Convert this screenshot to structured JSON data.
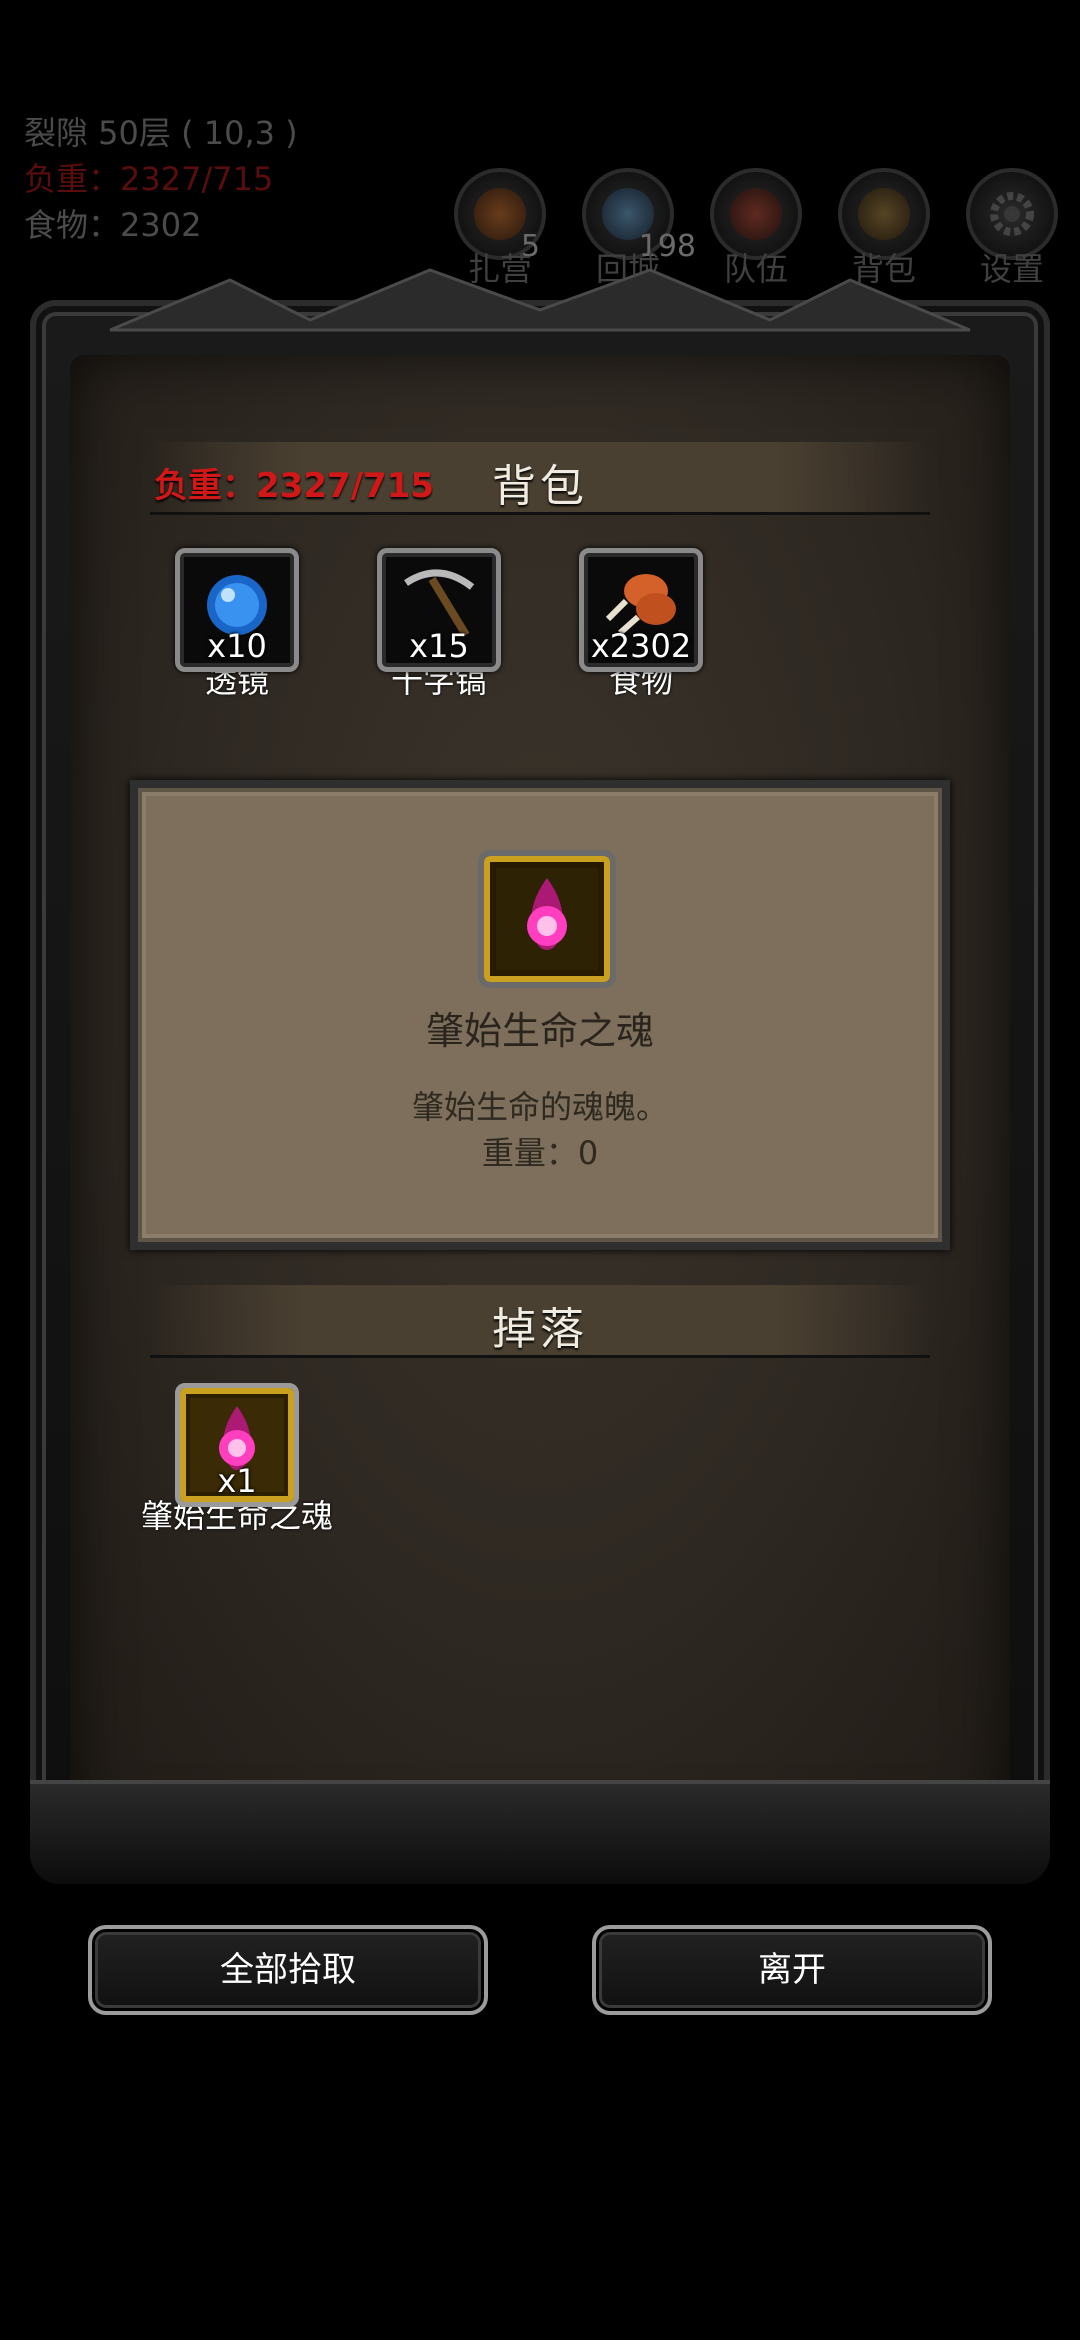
{
  "hud": {
    "location": "裂隙 50层 ( 10,3 )",
    "weight": "负重：2327/715",
    "food": "食物：2302"
  },
  "topbar": [
    {
      "label": "扎营",
      "badge": "5",
      "icon": "campfire-icon"
    },
    {
      "label": "回城",
      "badge": "198",
      "icon": "portal-icon"
    },
    {
      "label": "队伍",
      "badge": "",
      "icon": "team-icon"
    },
    {
      "label": "背包",
      "badge": "",
      "icon": "backpack-icon"
    },
    {
      "label": "设置",
      "badge": "",
      "icon": "gear-icon"
    }
  ],
  "backpack": {
    "title": "背包",
    "weight": "负重：2327/715",
    "items": [
      {
        "name": "透镜",
        "count": "x10",
        "icon": "lens-icon"
      },
      {
        "name": "十字镐",
        "count": "x15",
        "icon": "pickaxe-icon"
      },
      {
        "name": "食物",
        "count": "x2302",
        "icon": "meat-icon"
      }
    ]
  },
  "detail": {
    "name": "肇始生命之魂",
    "description": "肇始生命的魂魄。",
    "weight": "重量：0",
    "icon": "soul-orb-icon"
  },
  "drops": {
    "title": "掉落",
    "items": [
      {
        "name": "肇始生命之魂",
        "count": "x1",
        "icon": "soul-orb-icon"
      }
    ]
  },
  "buttons": {
    "pick_all": "全部拾取",
    "leave": "离开"
  },
  "colors": {
    "weight_red": "#d01818",
    "gold_frame": "#c9a020",
    "soul_pink": "#ff3fbf"
  }
}
